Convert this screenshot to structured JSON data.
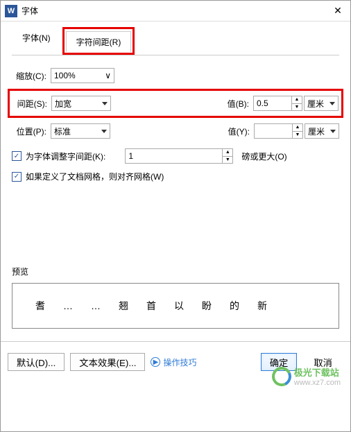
{
  "title": "字体",
  "app_icon_letter": "W",
  "tabs": {
    "font": "字体(N)",
    "spacing": "字符间距(R)"
  },
  "fields": {
    "scale": {
      "label": "缩放(C):",
      "value": "100%"
    },
    "spacing": {
      "label": "间距(S):",
      "value": "加宽"
    },
    "spacing_val": {
      "label": "值(B):",
      "value": "0.5",
      "unit": "厘米"
    },
    "position": {
      "label": "位置(P):",
      "value": "标准"
    },
    "position_val": {
      "label": "值(Y):",
      "value": "",
      "unit": "厘米"
    },
    "kerning": {
      "label": "为字体调整字间距(K):",
      "value": "1",
      "suffix": "磅或更大(O)"
    },
    "grid": {
      "label": "如果定义了文档网格，则对齐网格(W)"
    }
  },
  "preview": {
    "label": "预览",
    "chars": [
      "耆",
      "…",
      "…",
      "翘",
      "首",
      "以",
      "盼",
      "的",
      "新"
    ]
  },
  "watermark": {
    "brand": "极光下载站",
    "url": "www.xz7.com"
  },
  "footer": {
    "default": "默认(D)...",
    "effects": "文本效果(E)...",
    "tips": "操作技巧",
    "ok": "确定",
    "cancel": "取消"
  }
}
